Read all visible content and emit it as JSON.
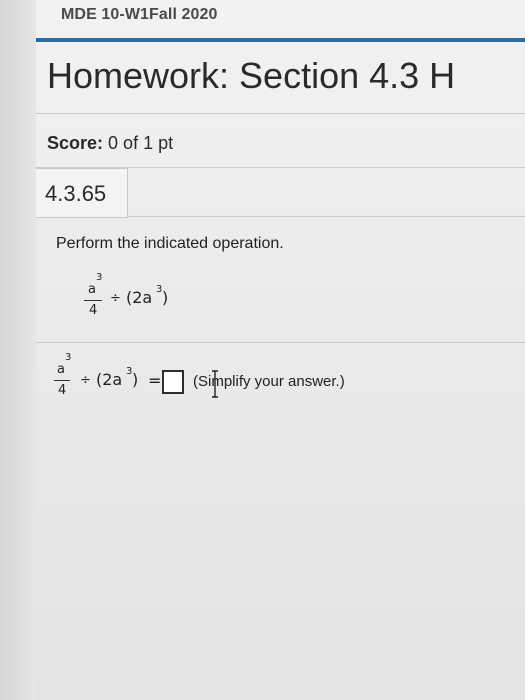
{
  "header": {
    "course_title": "MDE 10-W1Fall 2020",
    "homework_title": "Homework: Section 4.3 H"
  },
  "score": {
    "label": "Score:",
    "value": "0 of 1 pt"
  },
  "question": {
    "number": "4.3.65",
    "prompt": "Perform the indicated operation.",
    "expression": {
      "numerator": "a",
      "numerator_exp": "3",
      "denominator": "4",
      "operator": "÷",
      "paren_term": "(2a",
      "paren_exp": "3",
      "paren_close": ")"
    },
    "answer": {
      "equals": "=",
      "value": "",
      "hint": "(Simplify your answer.)"
    }
  },
  "colors": {
    "accent_rule": "#2f6aa3",
    "background": "#ebebeb"
  }
}
